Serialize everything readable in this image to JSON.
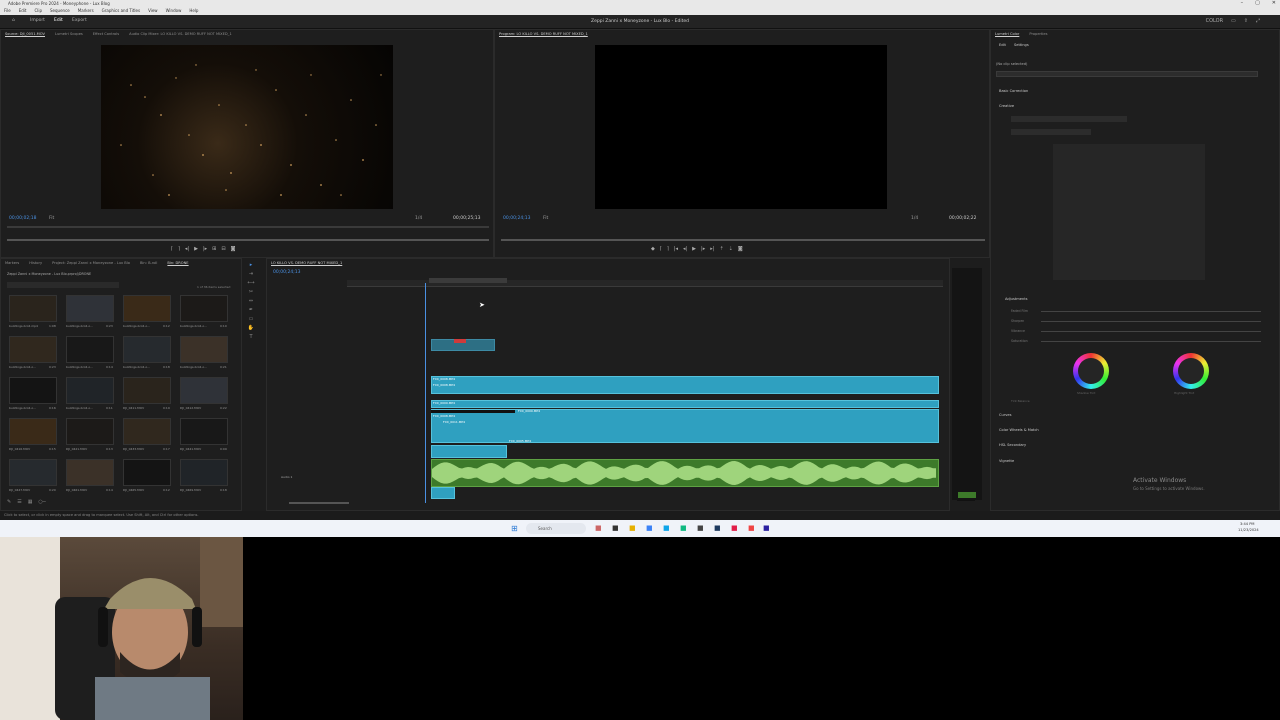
{
  "window": {
    "title": "Adobe Premiere Pro 2024 - Moneyphone - Lux Blog",
    "controls": [
      "–",
      "▢",
      "✕"
    ]
  },
  "menu": [
    "File",
    "Edit",
    "Clip",
    "Sequence",
    "Markers",
    "Graphics and Titles",
    "View",
    "Window",
    "Help"
  ],
  "appbar": {
    "tabs": [
      "Import",
      "Edit",
      "Export"
    ],
    "active_tab": "Edit",
    "project_title": "Zeppi Zanni x Moneyzone - Lux Blo - Edited",
    "right_label": "COLOR"
  },
  "source_monitor": {
    "tabs": [
      "Source: DJI_0051.MOV",
      "Lumetri Scopes",
      "Effect Controls",
      "Audio Clip Mixer: LO KILLO VS. DEMO RUFF NOT MIXED_1"
    ],
    "timecode_left": "00;00;02;18",
    "fit": "Fit",
    "resolution": "1/4",
    "timecode_right": "00;00;25;13"
  },
  "program_monitor": {
    "tabs": [
      "Program: LO KILLO VS. DEMO RUFF NOT MIXED_1"
    ],
    "timecode_left": "00;00;24;13",
    "fit": "Fit",
    "resolution": "1/4",
    "timecode_right": "00;00;02;22"
  },
  "project_panel": {
    "tabs": [
      "Markers",
      "History",
      "Project: Zeppi Zanni x Moneyzone - Lux Blo",
      "Bin: B-roll",
      "Bin: DRONE"
    ],
    "path": "Zeppi Zanni x Moneyzone - Lux Blo.prproj\\DRONE",
    "selected_count": "1 of 36 items selected",
    "items": [
      {
        "name": "buildings-broll.mp4",
        "dur": "1:08"
      },
      {
        "name": "buildings-broll-o...",
        "dur": "0:23"
      },
      {
        "name": "buildings-broll-o...",
        "dur": "0:12"
      },
      {
        "name": "buildings-broll-o...",
        "dur": "0:10"
      },
      {
        "name": "buildings-broll-o...",
        "dur": "0:23"
      },
      {
        "name": "buildings-broll-o...",
        "dur": "0:14"
      },
      {
        "name": "buildings-broll-o...",
        "dur": "0:18"
      },
      {
        "name": "buildings-broll-o...",
        "dur": "0:21"
      },
      {
        "name": "buildings-broll-o...",
        "dur": "0:16"
      },
      {
        "name": "buildings-broll-o...",
        "dur": "0:11"
      },
      {
        "name": "DJI_0411.MOV",
        "dur": "0:19"
      },
      {
        "name": "DJI_0412.MOV",
        "dur": "0:22"
      },
      {
        "name": "DJI_0416.MOV",
        "dur": "0:15"
      },
      {
        "name": "DJI_0421.MOV",
        "dur": "0:13"
      },
      {
        "name": "DJI_0433.MOV",
        "dur": "0:17"
      },
      {
        "name": "DJI_0441.MOV",
        "dur": "0:09"
      },
      {
        "name": "DJI_0447.MOV",
        "dur": "0:20"
      },
      {
        "name": "DJI_0461.MOV",
        "dur": "0:14"
      },
      {
        "name": "DJI_0465.MOV",
        "dur": "0:12"
      },
      {
        "name": "DJI_0469.MOV",
        "dur": "0:18"
      }
    ]
  },
  "timeline": {
    "tab": "LO KILLO VS. DEMO RUFF NOT MIXED_1",
    "timecode": "00;00;24;13",
    "clips": [
      "FX0_0008.MP4",
      "FX0_0008.MP4",
      "FX0_0009.MP4",
      "FX0_0009.MP4",
      "FX0_0008.MP4",
      "FX0_0011.MP4",
      "FX0_0005.MP4",
      "Audio 1"
    ]
  },
  "lumetri": {
    "tabs": [
      "Lumetri Color",
      "Properties"
    ],
    "subtabs": [
      "Edit",
      "Settings"
    ],
    "no_clip": "(No clip selected)",
    "sections": [
      "Basic Correction",
      "Creative",
      "Adjustments",
      "Curves",
      "Color Wheels & Match",
      "HSL Secondary",
      "Vignette"
    ],
    "adjustments": [
      "Faded Film",
      "Sharpen",
      "Vibrance",
      "Saturation"
    ],
    "wheel_labels": [
      "Shadow Tint",
      "Highlight Tint"
    ],
    "tint_balance": "Tint Balance"
  },
  "activate": {
    "title": "Activate Windows",
    "subtitle": "Go to Settings to activate Windows."
  },
  "status": "Click to select, or click in empty space and drag to marquee select. Use Shift, Alt, and Ctrl for other options.",
  "taskbar": {
    "search": "Search",
    "time": "3:44 PM",
    "date": "11/23/2024"
  },
  "colors": {
    "accent": "#4a90e2",
    "clip_blue": "#2fa0c0",
    "clip_green": "#3d7a2a",
    "panel_bg": "#1e1e1e"
  }
}
